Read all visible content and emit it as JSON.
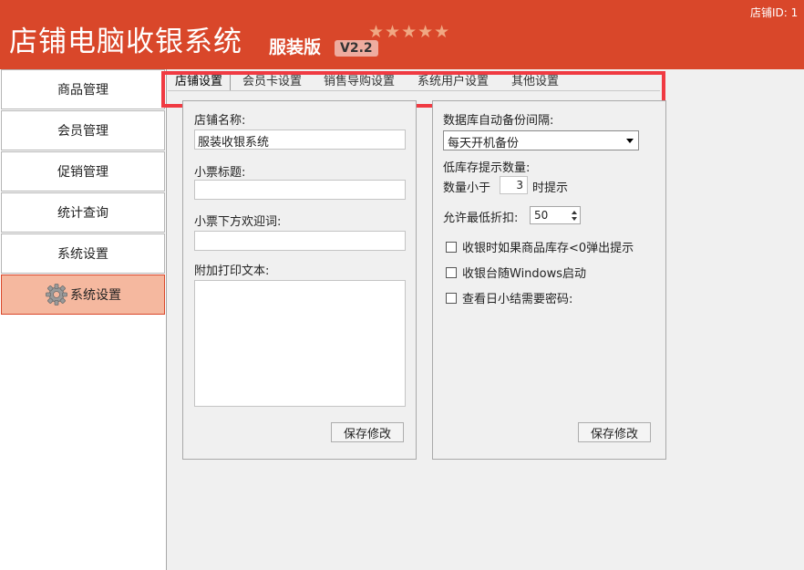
{
  "header": {
    "title": "店铺电脑收银系统",
    "edition": "服装版",
    "version": "V2.2",
    "stars": "★★★★★",
    "store_id_label": "店铺ID: 1"
  },
  "sidebar": {
    "items": [
      {
        "label": "商品管理"
      },
      {
        "label": "会员管理"
      },
      {
        "label": "促销管理"
      },
      {
        "label": "统计查询"
      },
      {
        "label": "系统设置"
      },
      {
        "label": "系统设置",
        "active": true,
        "icon": "gear-icon"
      }
    ]
  },
  "tabs": [
    {
      "label": "店铺设置",
      "active": true
    },
    {
      "label": "会员卡设置"
    },
    {
      "label": "销售导购设置"
    },
    {
      "label": "系统用户设置"
    },
    {
      "label": "其他设置"
    }
  ],
  "left_panel": {
    "store_name_label": "店铺名称:",
    "store_name_value": "服装收银系统",
    "receipt_title_label": "小票标题:",
    "receipt_title_value": "",
    "welcome_label": "小票下方欢迎词:",
    "welcome_value": "",
    "extra_text_label": "附加打印文本:",
    "extra_text_value": "",
    "save_label": "保存修改"
  },
  "right_panel": {
    "backup_label": "数据库自动备份间隔:",
    "backup_value": "每天开机备份",
    "low_stock_label": "低库存提示数量:",
    "qty_less_label": "数量小于",
    "qty_value": "3",
    "qty_suffix": "时提示",
    "discount_label": "允许最低折扣:",
    "discount_value": "50",
    "checkboxes": [
      {
        "label": "收银时如果商品库存<0弹出提示",
        "checked": false
      },
      {
        "label": "收银台随Windows启动",
        "checked": false
      },
      {
        "label": "查看日小结需要密码:",
        "checked": false
      }
    ],
    "save_label": "保存修改"
  },
  "colors": {
    "header": "#d9472a",
    "active_item": "#f5b89f",
    "highlight_box": "#f03a42"
  }
}
